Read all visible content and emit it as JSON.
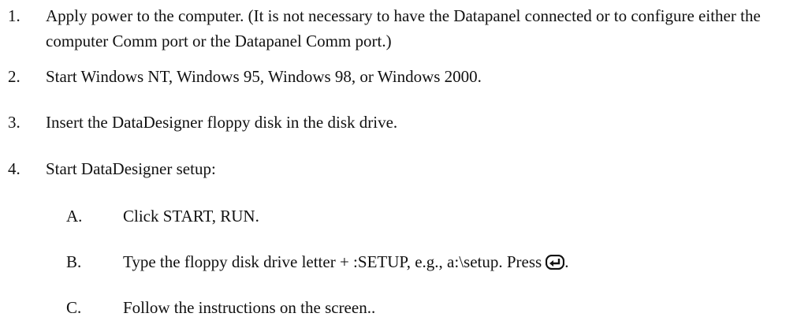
{
  "steps": [
    {
      "number": "1.",
      "text": "Apply power to the computer. (It is not necessary to have the Datapanel connected or to configure either the computer Comm port or the Datapanel Comm port.)"
    },
    {
      "number": "2.",
      "text": "Start Windows NT, Windows 95, Windows 98, or Windows 2000."
    },
    {
      "number": "3.",
      "text": "Insert the DataDesigner floppy disk in the disk drive."
    },
    {
      "number": "4.",
      "text": "Start DataDesigner setup:"
    }
  ],
  "substeps": [
    {
      "letter": "A.",
      "text": "Click START, RUN."
    },
    {
      "letter": "B.",
      "text": "Type the floppy disk drive letter + :SETUP, e.g., a:\\setup. Press",
      "icon": "enter-key-icon",
      "trailing": "."
    },
    {
      "letter": "C.",
      "text": "Follow the instructions on the screen.."
    }
  ]
}
